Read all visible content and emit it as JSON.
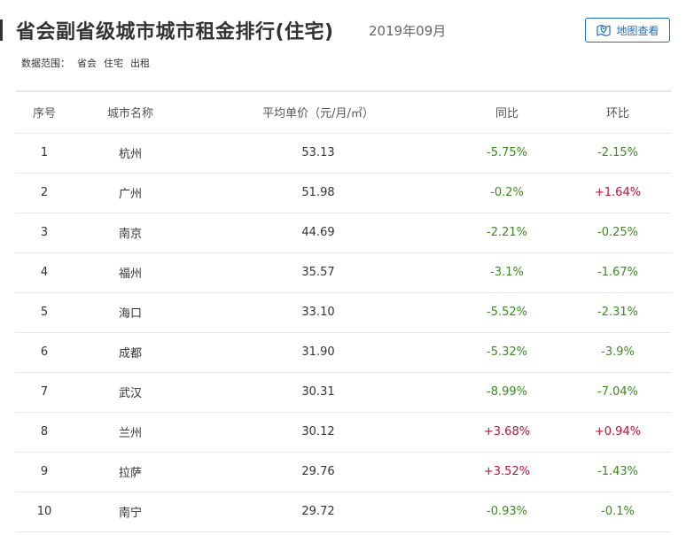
{
  "header": {
    "title": "省会副省级城市城市租金排行(住宅)",
    "date": "2019年09月",
    "map_button_label": "地图查看"
  },
  "scope": {
    "label": "数据范围：",
    "tags": [
      "省会",
      "住宅",
      "出租"
    ]
  },
  "table": {
    "columns": [
      "序号",
      "城市名称",
      "平均单价（元/月/㎡）",
      "同比",
      "环比"
    ],
    "rows": [
      {
        "idx": "1",
        "city": "杭州",
        "price": "53.13",
        "yoy": "-5.75%",
        "mom": "-2.15%"
      },
      {
        "idx": "2",
        "city": "广州",
        "price": "51.98",
        "yoy": "-0.2%",
        "mom": "+1.64%"
      },
      {
        "idx": "3",
        "city": "南京",
        "price": "44.69",
        "yoy": "-2.21%",
        "mom": "-0.25%"
      },
      {
        "idx": "4",
        "city": "福州",
        "price": "35.57",
        "yoy": "-3.1%",
        "mom": "-1.67%"
      },
      {
        "idx": "5",
        "city": "海口",
        "price": "33.10",
        "yoy": "-5.52%",
        "mom": "-2.31%"
      },
      {
        "idx": "6",
        "city": "成都",
        "price": "31.90",
        "yoy": "-5.32%",
        "mom": "-3.9%"
      },
      {
        "idx": "7",
        "city": "武汉",
        "price": "30.31",
        "yoy": "-8.99%",
        "mom": "-7.04%"
      },
      {
        "idx": "8",
        "city": "兰州",
        "price": "30.12",
        "yoy": "+3.68%",
        "mom": "+0.94%"
      },
      {
        "idx": "9",
        "city": "拉萨",
        "price": "29.76",
        "yoy": "+3.52%",
        "mom": "-1.43%"
      },
      {
        "idx": "10",
        "city": "南宁",
        "price": "29.72",
        "yoy": "-0.93%",
        "mom": "-0.1%"
      }
    ]
  },
  "colors": {
    "negative": "#3c8a1f",
    "positive": "#c0103a",
    "accent": "#1f6fbf"
  },
  "icons": {
    "map_button": "map-location-icon"
  }
}
